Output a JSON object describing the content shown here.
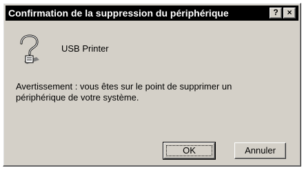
{
  "dialog": {
    "title": "Confirmation de la suppression du périphérique",
    "help_label": "?",
    "close_label": "×",
    "device_name": "USB Printer",
    "warning_text": "Avertissement : vous êtes sur le point de supprimer un périphérique de votre système.",
    "ok_label": "OK",
    "cancel_label": "Annuler",
    "icon": "question-device-icon"
  }
}
